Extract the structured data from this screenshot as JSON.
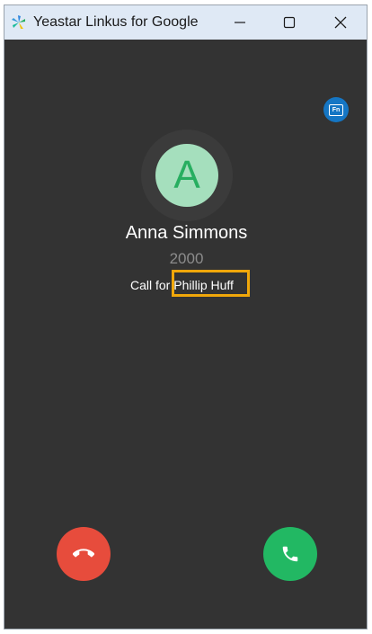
{
  "window": {
    "title": "Yeastar Linkus for Google"
  },
  "call": {
    "avatar_initial": "A",
    "caller_name": "Anna Simmons",
    "caller_number": "2000",
    "call_for_prefix": "Call for",
    "call_for_name": "Phillip Huff"
  },
  "icons": {
    "app": "yeastar-logo-icon",
    "minimize": "minimize-icon",
    "maximize": "maximize-icon",
    "close": "close-icon",
    "fn": "fn-key-icon",
    "hangup": "phone-hangup-icon",
    "answer": "phone-answer-icon"
  },
  "colors": {
    "background": "#333333",
    "titlebar": "#dfe9f5",
    "avatar_bg": "#a5dfbd",
    "avatar_text": "#27ae60",
    "hangup": "#e74c3c",
    "answer": "#22b863",
    "highlight": "#f0a70a",
    "fn_badge": "#1576c4"
  }
}
